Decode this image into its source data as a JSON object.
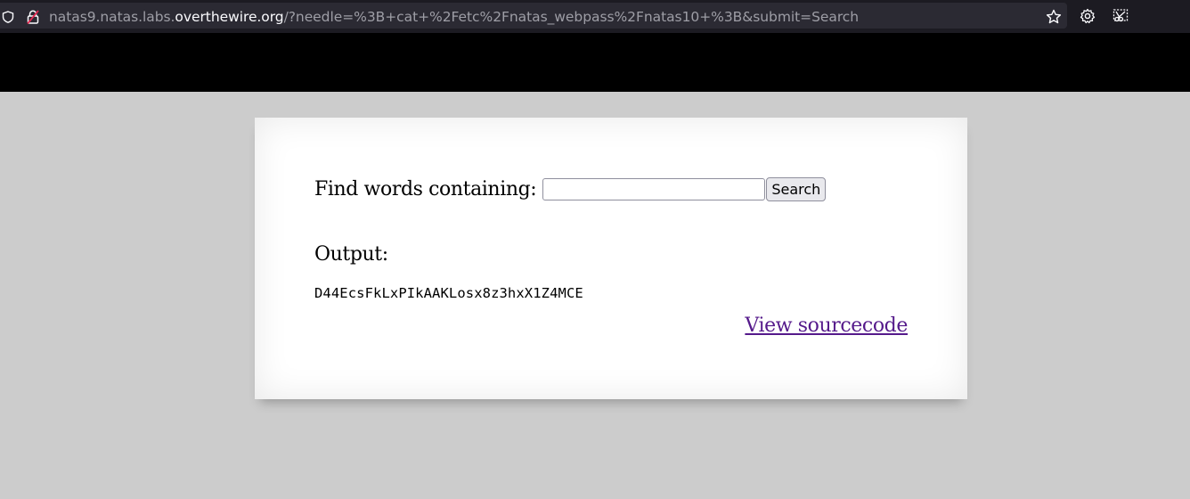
{
  "browser": {
    "url_prefix": "natas9.natas.labs.",
    "url_domain": "overthewire.org",
    "url_path": "/?needle=%3B+cat+%2Fetc%2Fnatas_webpass%2Fnatas10+%3B&submit=Search",
    "icons": [
      "shield-icon",
      "insecure-lock-icon",
      "bookmark-star-icon",
      "gear-icon",
      "screenshot-icon"
    ]
  },
  "form": {
    "label": "Find words containing:",
    "input_value": "",
    "button_label": "Search"
  },
  "output": {
    "heading": "Output:",
    "text": "D44EcsFkLxPIkAAKLosx8z3hxX1Z4MCE"
  },
  "footer": {
    "link_label": "View sourcecode"
  },
  "colors": {
    "page_background": "#cccccc",
    "header_band": "#000000",
    "link_visited": "#551a8b",
    "toolbar": "#1c1b22"
  }
}
